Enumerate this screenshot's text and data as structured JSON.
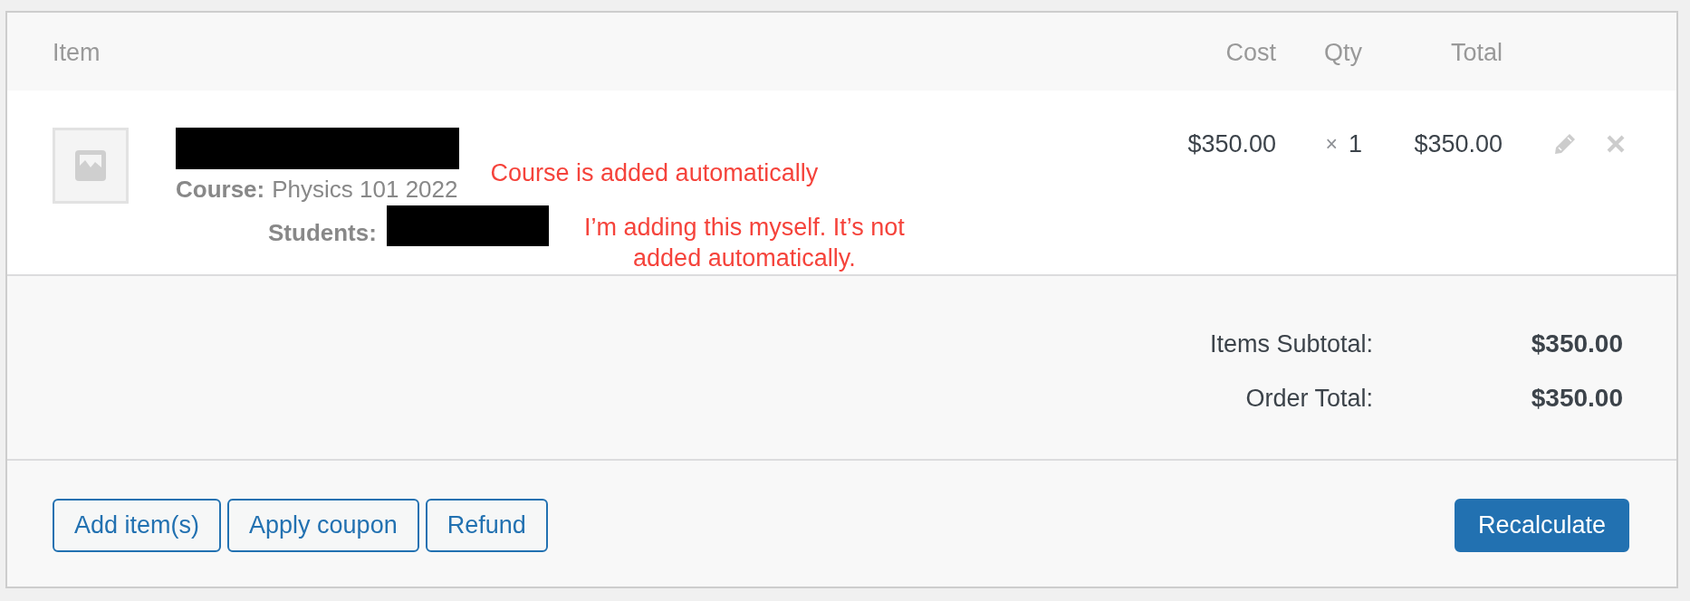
{
  "columns": [
    {
      "label": "Item"
    },
    {
      "label": "Cost"
    },
    {
      "label": "Qty"
    },
    {
      "label": "Total"
    }
  ],
  "line_items": [
    {
      "title_redacted": true,
      "meta": [
        {
          "label": "Course:",
          "value": "Physics 101 2022",
          "annotation": "Course is added automatically",
          "children": [
            {
              "label": "Students:",
              "redacted": true,
              "annotation": "I’m adding this myself. It’s not added automatically."
            }
          ]
        }
      ],
      "cost": "$350.00",
      "qty_sign": "×",
      "qty": "1",
      "total": "$350.00"
    }
  ],
  "totals": [
    {
      "label": "Items Subtotal:",
      "amount": "$350.00"
    },
    {
      "label": "Order Total:",
      "amount": "$350.00"
    }
  ],
  "buttons": [
    {
      "label": "Add item(s)",
      "kind": "secondary"
    },
    {
      "label": "Apply coupon",
      "kind": "secondary"
    },
    {
      "label": "Refund",
      "kind": "secondary"
    },
    {
      "label": "Recalculate",
      "kind": "primary"
    }
  ]
}
